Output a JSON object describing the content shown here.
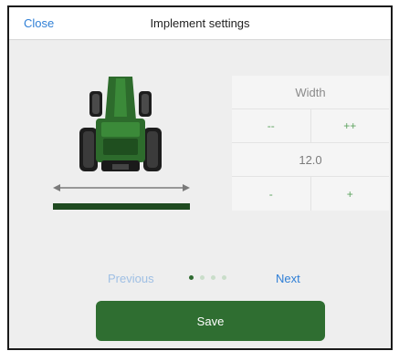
{
  "header": {
    "close_label": "Close",
    "title": "Implement settings"
  },
  "width_panel": {
    "label": "Width",
    "decrease_large": "--",
    "increase_large": "++",
    "value": "12.0",
    "decrease_small": "-",
    "increase_small": "+"
  },
  "pager": {
    "previous_label": "Previous",
    "next_label": "Next",
    "page_count": 4,
    "current_page": 1
  },
  "save_label": "Save",
  "colors": {
    "accent_blue": "#2f7fd6",
    "brand_green": "#2f6e31",
    "tractor_green": "#2d6b2c",
    "implement_bar": "#1f4a20"
  },
  "icons": {
    "vehicle": "tractor-rear-icon",
    "width_arrow": "double-arrow-icon"
  }
}
